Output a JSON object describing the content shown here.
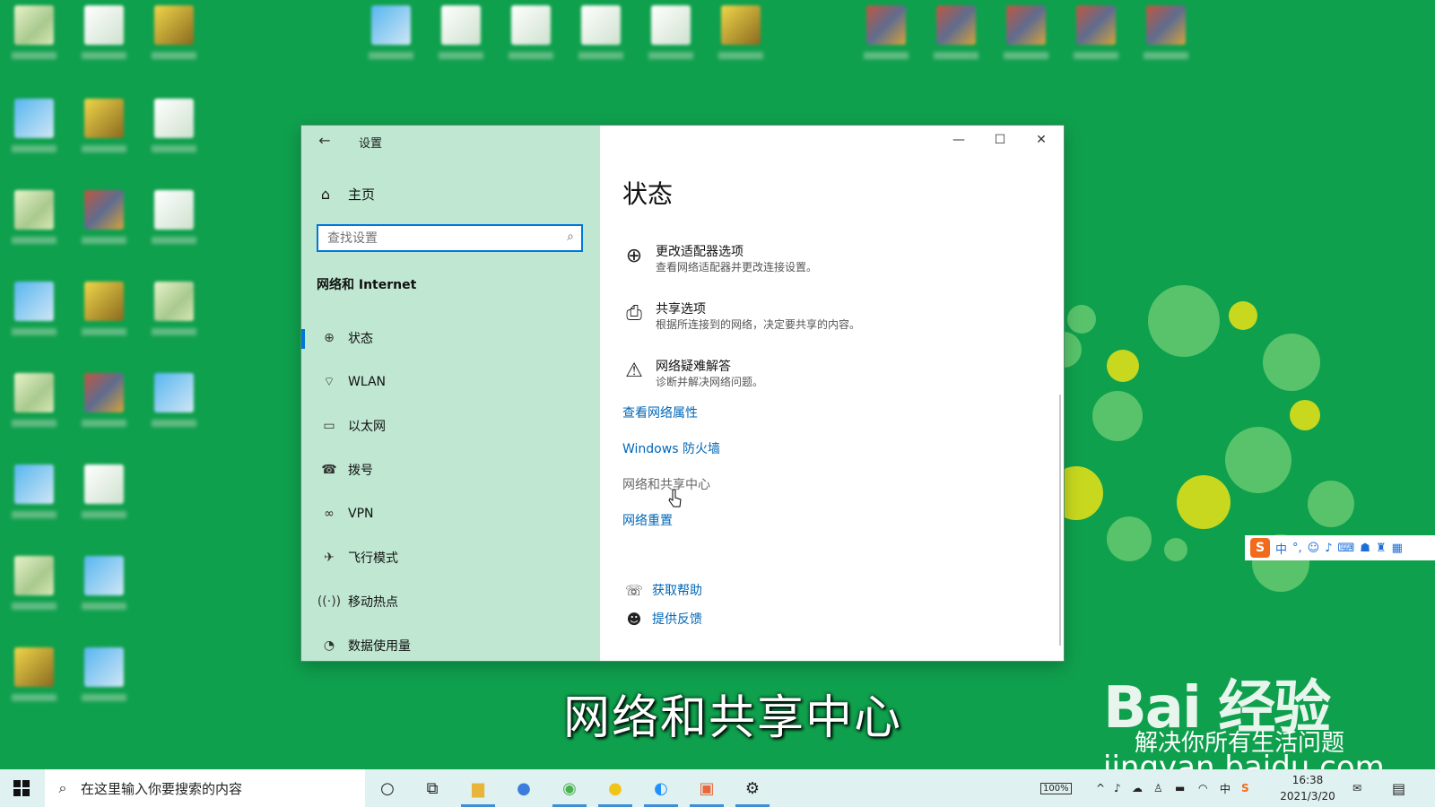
{
  "window": {
    "title": "设置",
    "back_glyph": "←",
    "minimize_glyph": "—",
    "maximize_glyph": "☐",
    "close_glyph": "✕"
  },
  "sidebar": {
    "home_label": "主页",
    "search_placeholder": "查找设置",
    "section_title": "网络和 Internet",
    "items": [
      {
        "label": "状态",
        "icon": "globe-icon"
      },
      {
        "label": "WLAN",
        "icon": "wifi-icon"
      },
      {
        "label": "以太网",
        "icon": "ethernet-icon"
      },
      {
        "label": "拨号",
        "icon": "dialup-icon"
      },
      {
        "label": "VPN",
        "icon": "vpn-icon"
      },
      {
        "label": "飞行模式",
        "icon": "airplane-icon"
      },
      {
        "label": "移动热点",
        "icon": "hotspot-icon"
      },
      {
        "label": "数据使用量",
        "icon": "data-usage-icon"
      }
    ]
  },
  "main": {
    "page_title": "状态",
    "options": [
      {
        "title": "更改适配器选项",
        "subtitle": "查看网络适配器并更改连接设置。",
        "icon": "adapter-icon"
      },
      {
        "title": "共享选项",
        "subtitle": "根据所连接到的网络，决定要共享的内容。",
        "icon": "sharing-icon"
      },
      {
        "title": "网络疑难解答",
        "subtitle": "诊断并解决网络问题。",
        "icon": "warning-icon"
      }
    ],
    "links": {
      "properties": "查看网络属性",
      "firewall": "Windows 防火墙",
      "sharing_center": "网络和共享中心",
      "reset": "网络重置"
    },
    "help": {
      "get_help": "获取帮助",
      "feedback": "提供反馈"
    }
  },
  "caption": "网络和共享中心",
  "watermark": {
    "brand": "Bai 经验",
    "slogan": "解决你所有生活问题",
    "url": "jingyan.baidu.com"
  },
  "ime": {
    "lang": "中"
  },
  "taskbar": {
    "search_placeholder": "在这里输入你要搜索的内容",
    "battery": "100%",
    "input_lang": "中",
    "time": "16:38",
    "date": "2021/3/20"
  }
}
